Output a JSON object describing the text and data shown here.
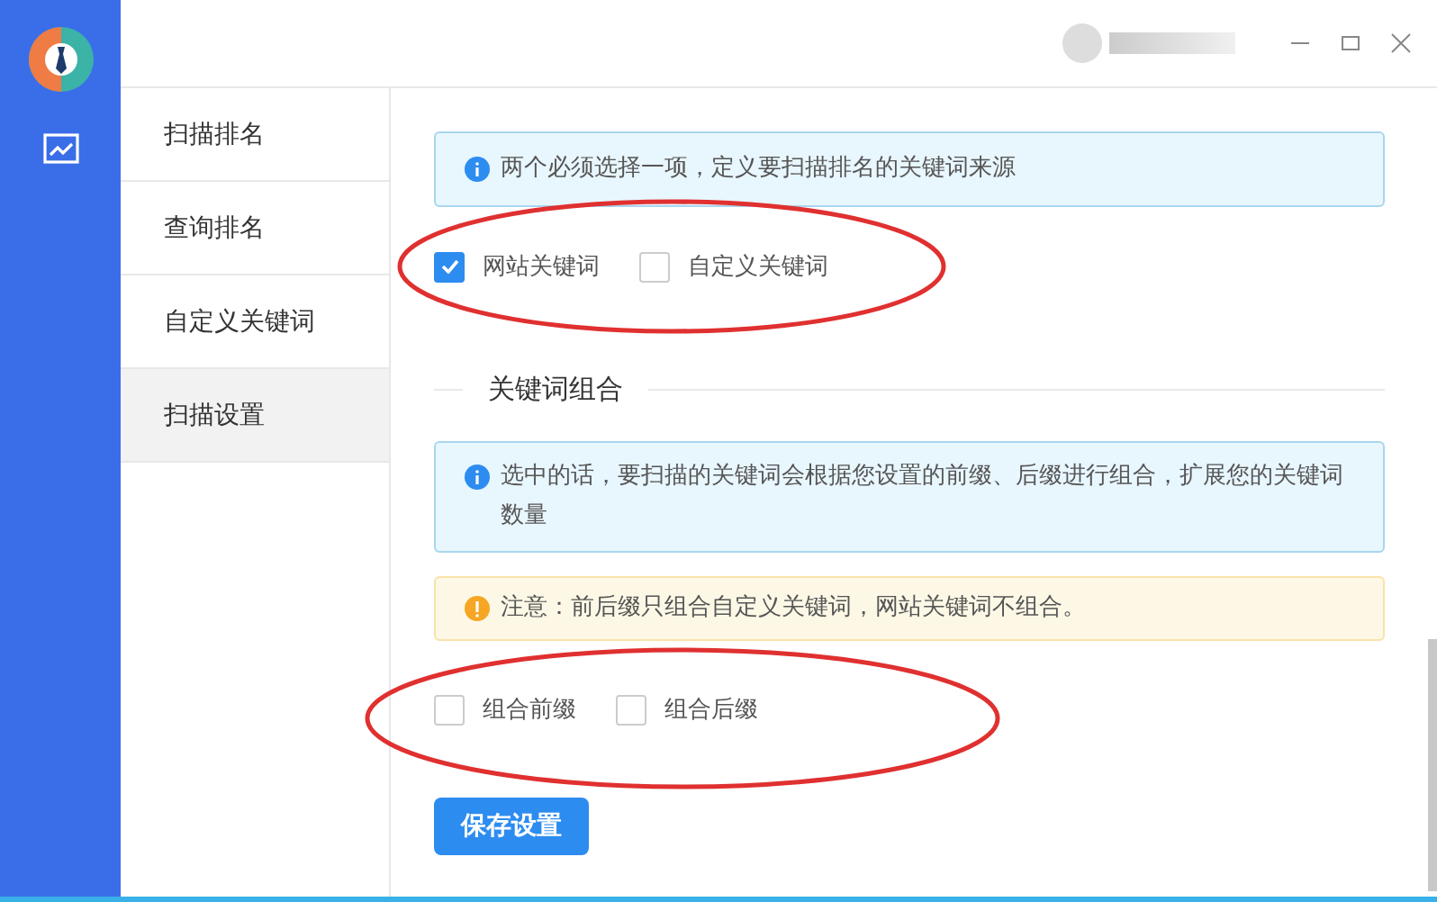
{
  "rail": {
    "items": [
      {
        "kind": "chart",
        "selected": false
      }
    ]
  },
  "nav": {
    "items": [
      {
        "label": "扫描排名",
        "selected": false
      },
      {
        "label": "查询排名",
        "selected": false
      },
      {
        "label": "自定义关键词",
        "selected": false
      },
      {
        "label": "扫描设置",
        "selected": true
      }
    ]
  },
  "source_section": {
    "info": "两个必须选择一项，定义要扫描排名的关键词来源",
    "options": [
      {
        "label": "网站关键词",
        "checked": true
      },
      {
        "label": "自定义关键词",
        "checked": false
      }
    ]
  },
  "combo_section": {
    "title": "关键词组合",
    "info": "选中的话，要扫描的关键词会根据您设置的前缀、后缀进行组合，扩展您的关键词数量",
    "warning": "注意：前后缀只组合自定义关键词，网站关键词不组合。",
    "options": [
      {
        "label": "组合前缀",
        "checked": false
      },
      {
        "label": "组合后缀",
        "checked": false
      }
    ]
  },
  "save_button": "保存设置"
}
